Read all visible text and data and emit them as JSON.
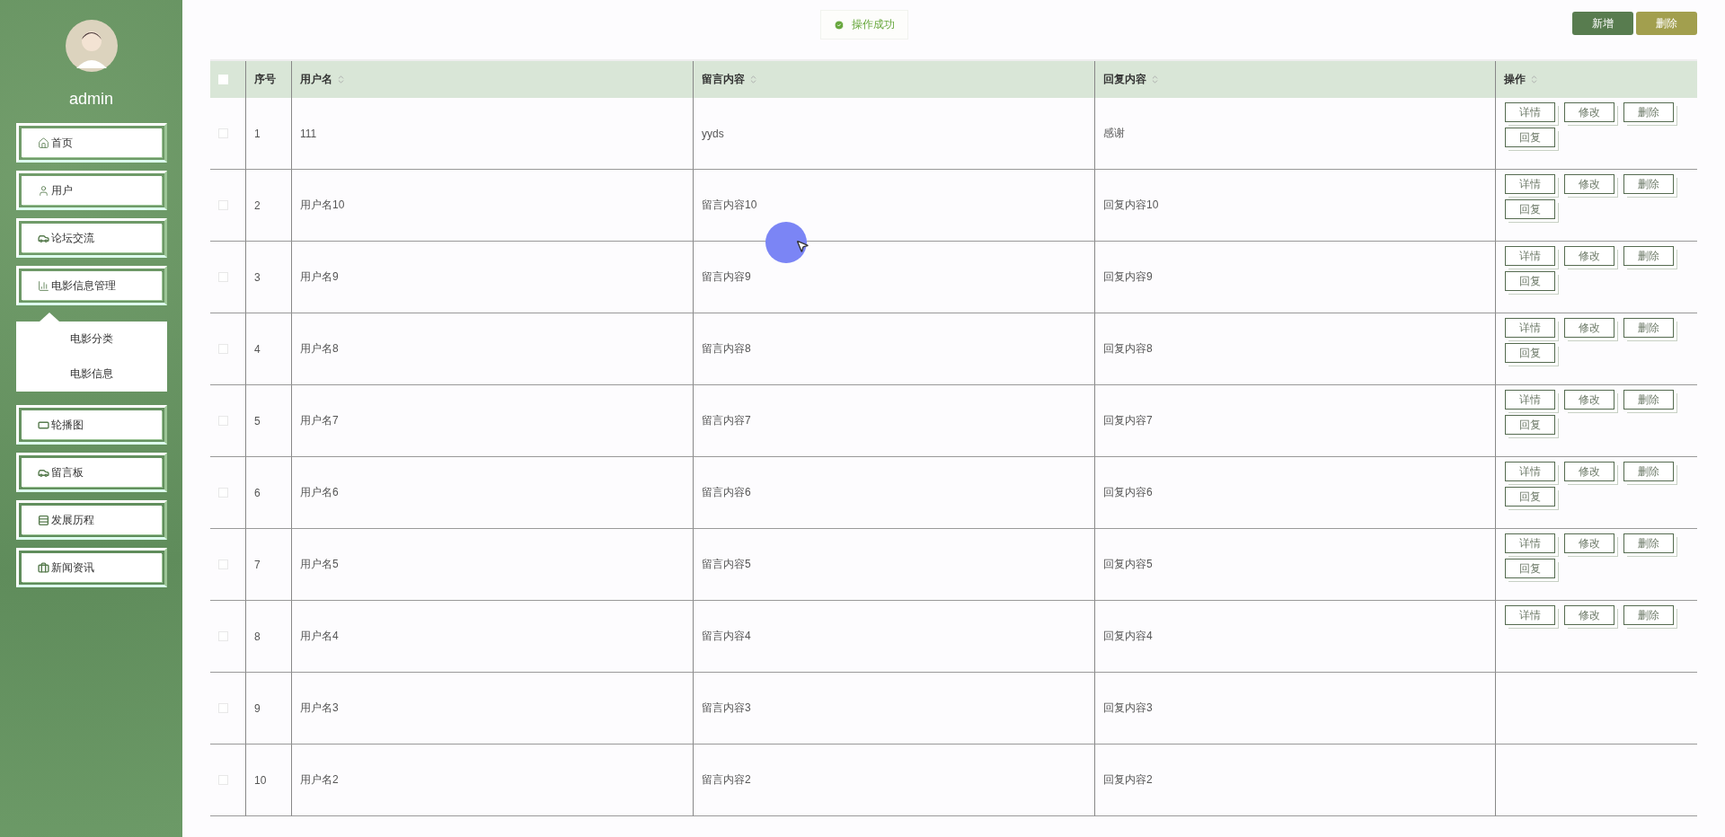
{
  "sidebar": {
    "user": {
      "name": "admin"
    },
    "items": [
      {
        "label": "首页"
      },
      {
        "label": "用户"
      },
      {
        "label": "论坛交流"
      },
      {
        "label": "电影信息管理",
        "expanded": true,
        "children": [
          {
            "label": "电影分类"
          },
          {
            "label": "电影信息"
          }
        ]
      },
      {
        "label": "轮播图"
      },
      {
        "label": "留言板"
      },
      {
        "label": "发展历程"
      },
      {
        "label": "新闻资讯"
      }
    ]
  },
  "toast": {
    "kind": "success",
    "text": "操作成功"
  },
  "toolbar": [
    {
      "label": "新增",
      "kind": "primary"
    },
    {
      "label": "删除",
      "kind": "warning"
    }
  ],
  "table": {
    "select_all": {
      "checked": false
    },
    "columns": [
      {
        "label": "序号",
        "sortable": false
      },
      {
        "label": "用户名",
        "sortable": true
      },
      {
        "label": "留言内容",
        "sortable": true
      },
      {
        "label": "回复内容",
        "sortable": true
      },
      {
        "label": "操作",
        "sortable": true
      }
    ],
    "rows": [
      {
        "checked": false,
        "cells": [
          "1",
          "111",
          "yyds",
          "感谢"
        ],
        "actions": [
          "详情",
          "修改",
          "删除",
          "回复"
        ]
      },
      {
        "checked": false,
        "cells": [
          "2",
          "用户名10",
          "留言内容10",
          "回复内容10"
        ],
        "actions": [
          "详情",
          "修改",
          "删除",
          "回复"
        ]
      },
      {
        "checked": false,
        "cells": [
          "3",
          "用户名9",
          "留言内容9",
          "回复内容9"
        ],
        "actions": [
          "详情",
          "修改",
          "删除",
          "回复"
        ]
      },
      {
        "checked": false,
        "cells": [
          "4",
          "用户名8",
          "留言内容8",
          "回复内容8"
        ],
        "actions": [
          "详情",
          "修改",
          "删除",
          "回复"
        ]
      },
      {
        "checked": false,
        "cells": [
          "5",
          "用户名7",
          "留言内容7",
          "回复内容7"
        ],
        "actions": [
          "详情",
          "修改",
          "删除",
          "回复"
        ]
      },
      {
        "checked": false,
        "cells": [
          "6",
          "用户名6",
          "留言内容6",
          "回复内容6"
        ],
        "actions": [
          "详情",
          "修改",
          "删除",
          "回复"
        ]
      },
      {
        "checked": false,
        "cells": [
          "7",
          "用户名5",
          "留言内容5",
          "回复内容5"
        ],
        "actions": [
          "详情",
          "修改",
          "删除",
          "回复"
        ]
      },
      {
        "checked": false,
        "cells": [
          "8",
          "用户名4",
          "留言内容4",
          "回复内容4"
        ],
        "actions": [
          "详情",
          "修改",
          "删除"
        ]
      },
      {
        "checked": false,
        "cells": [
          "9",
          "用户名3",
          "留言内容3",
          "回复内容3"
        ]
      },
      {
        "checked": false,
        "cells": [
          "10",
          "用户名2",
          "留言内容2",
          "回复内容2"
        ]
      }
    ]
  }
}
